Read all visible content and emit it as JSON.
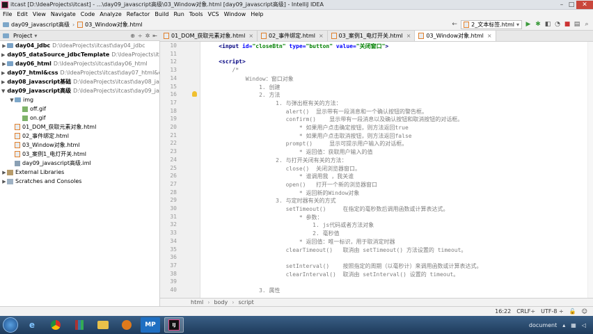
{
  "window": {
    "title": "itcast [D:\\IdeaProjects\\itcast] - ...\\day09_javascript高级\\03_Window对象.html [day09_javascript高级] - IntelliJ IDEA",
    "minimize": "–",
    "maximize": "□",
    "close": "✕"
  },
  "menu": [
    "File",
    "Edit",
    "View",
    "Navigate",
    "Code",
    "Analyze",
    "Refactor",
    "Build",
    "Run",
    "Tools",
    "VCS",
    "Window",
    "Help"
  ],
  "breadcrumb": {
    "project": "day09_javascript高级",
    "file": "03_Window对象.html"
  },
  "run_config": "2_文本标签.html",
  "project_panel": {
    "title": "Project"
  },
  "tree": [
    {
      "indent": 0,
      "arrow": "▶",
      "icon": "mod",
      "name": "day04_jdbc",
      "path": "D:\\IdeaProjects\\itcast\\day04_jdbc",
      "bold": true
    },
    {
      "indent": 0,
      "arrow": "▶",
      "icon": "mod",
      "name": "day05_dataSource_jdbcTemplate",
      "path": "D:\\IdeaProjects\\itcast",
      "bold": true
    },
    {
      "indent": 0,
      "arrow": "▶",
      "icon": "mod",
      "name": "day06_html",
      "path": "D:\\IdeaProjects\\itcast\\day06_html",
      "bold": true
    },
    {
      "indent": 0,
      "arrow": "▶",
      "icon": "mod",
      "name": "day07_html&css",
      "path": "D:\\IdeaProjects\\itcast\\day07_html&css",
      "bold": true
    },
    {
      "indent": 0,
      "arrow": "▶",
      "icon": "mod",
      "name": "day08_javascript基础",
      "path": "D:\\IdeaProjects\\itcast\\day08_java",
      "bold": true
    },
    {
      "indent": 0,
      "arrow": "▼",
      "icon": "mod",
      "name": "day09_javascript高级",
      "path": "D:\\IdeaProjects\\itcast\\day09_java",
      "bold": true
    },
    {
      "indent": 1,
      "arrow": "▼",
      "icon": "folder",
      "name": "img",
      "path": "",
      "bold": false
    },
    {
      "indent": 2,
      "arrow": "",
      "icon": "gif",
      "name": "off.gif",
      "path": "",
      "bold": false
    },
    {
      "indent": 2,
      "arrow": "",
      "icon": "gif",
      "name": "on.gif",
      "path": "",
      "bold": false
    },
    {
      "indent": 1,
      "arrow": "",
      "icon": "html",
      "name": "01_DOM_获取元素对象.html",
      "path": "",
      "bold": false
    },
    {
      "indent": 1,
      "arrow": "",
      "icon": "html",
      "name": "02_事件绑定.html",
      "path": "",
      "bold": false
    },
    {
      "indent": 1,
      "arrow": "",
      "icon": "html",
      "name": "03_Window对象.html",
      "path": "",
      "bold": false
    },
    {
      "indent": 1,
      "arrow": "",
      "icon": "html",
      "name": "03_案例1_电灯开关.html",
      "path": "",
      "bold": false
    },
    {
      "indent": 1,
      "arrow": "",
      "icon": "iml",
      "name": "day09_javascript高级.iml",
      "path": "",
      "bold": false
    },
    {
      "indent": 0,
      "arrow": "▶",
      "icon": "lib",
      "name": "External Libraries",
      "path": "",
      "bold": false
    },
    {
      "indent": 0,
      "arrow": "▶",
      "icon": "scr",
      "name": "Scratches and Consoles",
      "path": "",
      "bold": false
    }
  ],
  "tabs": [
    {
      "label": "01_DOM_获取元素对象.html",
      "active": false
    },
    {
      "label": "02_事件绑定.html",
      "active": false
    },
    {
      "label": "03_案例1_电灯开关.html",
      "active": false
    },
    {
      "label": "03_Window对象.html",
      "active": true
    }
  ],
  "code_lines": [
    {
      "n": "10",
      "t": "    <input id=\"closeBtn\" type=\"button\" value=\"关闭窗口\">",
      "k": "tagline"
    },
    {
      "n": "11",
      "t": "",
      "k": "plain"
    },
    {
      "n": "12",
      "t": "    <script>",
      "k": "tag"
    },
    {
      "n": "13",
      "t": "        /*",
      "k": "cm"
    },
    {
      "n": "14",
      "t": "            Window：窗口对象",
      "k": "cm"
    },
    {
      "n": "15",
      "t": "                1. 创建",
      "k": "cm"
    },
    {
      "n": "16",
      "t": "                2. 方法",
      "k": "cm"
    },
    {
      "n": "17",
      "t": "                     1. 与弹出框有关的方法：",
      "k": "cm"
    },
    {
      "n": "18",
      "t": "                        alert()  显示带有一段消息和一个确认按钮的警告框。",
      "k": "cm"
    },
    {
      "n": "19",
      "t": "                        confirm()    显示带有一段消息以及确认按钮和取消按钮的对话框。",
      "k": "cm"
    },
    {
      "n": "20",
      "t": "                            * 如果用户点击确定按钮，则方法返回true",
      "k": "cm"
    },
    {
      "n": "21",
      "t": "                            * 如果用户点击取消按钮，则方法返回false",
      "k": "cm"
    },
    {
      "n": "22",
      "t": "                        prompt()     显示可提示用户输入的对话框。",
      "k": "cm"
    },
    {
      "n": "23",
      "t": "                            * 返回值：获取用户输入的值",
      "k": "cm"
    },
    {
      "n": "24",
      "t": "                     2. 与打开关闭有关的方法：",
      "k": "cm"
    },
    {
      "n": "25",
      "t": "                        close()  关闭浏览器窗口。",
      "k": "cm"
    },
    {
      "n": "26",
      "t": "                            * 谁调用我 ，我关谁",
      "k": "cm"
    },
    {
      "n": "27",
      "t": "                        open()   打开一个新的浏览器窗口",
      "k": "cm"
    },
    {
      "n": "28",
      "t": "                            * 返回新的Window对象",
      "k": "cm"
    },
    {
      "n": "29",
      "t": "                     3. 与定时器有关的方式",
      "k": "cm"
    },
    {
      "n": "30",
      "t": "                        setTimeout()     在指定的毫秒数后调用函数或计算表达式。",
      "k": "cm"
    },
    {
      "n": "31",
      "t": "                            * 参数：",
      "k": "cm"
    },
    {
      "n": "32",
      "t": "                                1. js代码或者方法对象",
      "k": "cm"
    },
    {
      "n": "33",
      "t": "                                2. 毫秒值",
      "k": "cm"
    },
    {
      "n": "34",
      "t": "                            * 返回值：唯一标识，用于取消定时器",
      "k": "cm"
    },
    {
      "n": "35",
      "t": "                        clearTimeout()   取消由 setTimeout() 方法设置的 timeout。",
      "k": "cm"
    },
    {
      "n": "36",
      "t": "",
      "k": "cm"
    },
    {
      "n": "37",
      "t": "                        setInterval()    按照指定的周期（以毫秒计）来调用函数或计算表达式。",
      "k": "cm"
    },
    {
      "n": "38",
      "t": "                        clearInterval()  取消由 setInterval() 设置的 timeout。",
      "k": "cm"
    },
    {
      "n": "39",
      "t": "",
      "k": "cm"
    },
    {
      "n": "40",
      "t": "                3. 属性",
      "k": "cm"
    }
  ],
  "input_line": {
    "pre": "    ",
    "open": "<input ",
    "id_attr": "id=",
    "id_val": "\"closeBtn\"",
    "type_attr": " type=",
    "type_val": "\"button\"",
    "value_attr": " value=",
    "value_val": "\"关闭窗口\"",
    "close": ">"
  },
  "editor_breadcrumb": [
    "html",
    "body",
    "script"
  ],
  "status": {
    "position": "16:22",
    "line_sep": "CRLF÷",
    "encoding": "UTF-8 ÷"
  },
  "taskbar": {
    "apps": [
      "e",
      "",
      "",
      "",
      "",
      "MP",
      "IJ"
    ],
    "tray_text": "document"
  }
}
